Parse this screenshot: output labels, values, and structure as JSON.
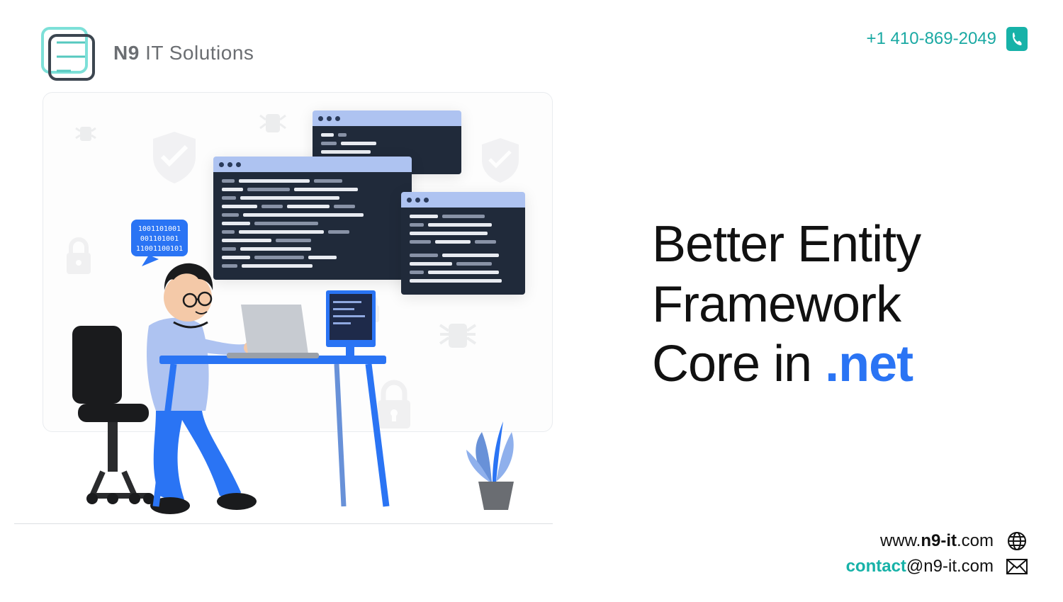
{
  "header": {
    "company_prefix": "N9",
    "company_suffix": " IT Solutions",
    "phone": "+1 410-869-2049"
  },
  "headline": {
    "line1": "Better Entity",
    "line2": "Framework",
    "line3_prefix": "Core in ",
    "line3_accent": ".net"
  },
  "footer": {
    "web_prefix": "www.",
    "web_bold": "n9-it",
    "web_suffix": ".com",
    "email_local": "contact",
    "email_at": "@",
    "email_domain": "n9-it.com"
  },
  "speech_bubble": {
    "l1": "1001101001",
    "l2": "001101001",
    "l3": "11001100101"
  }
}
